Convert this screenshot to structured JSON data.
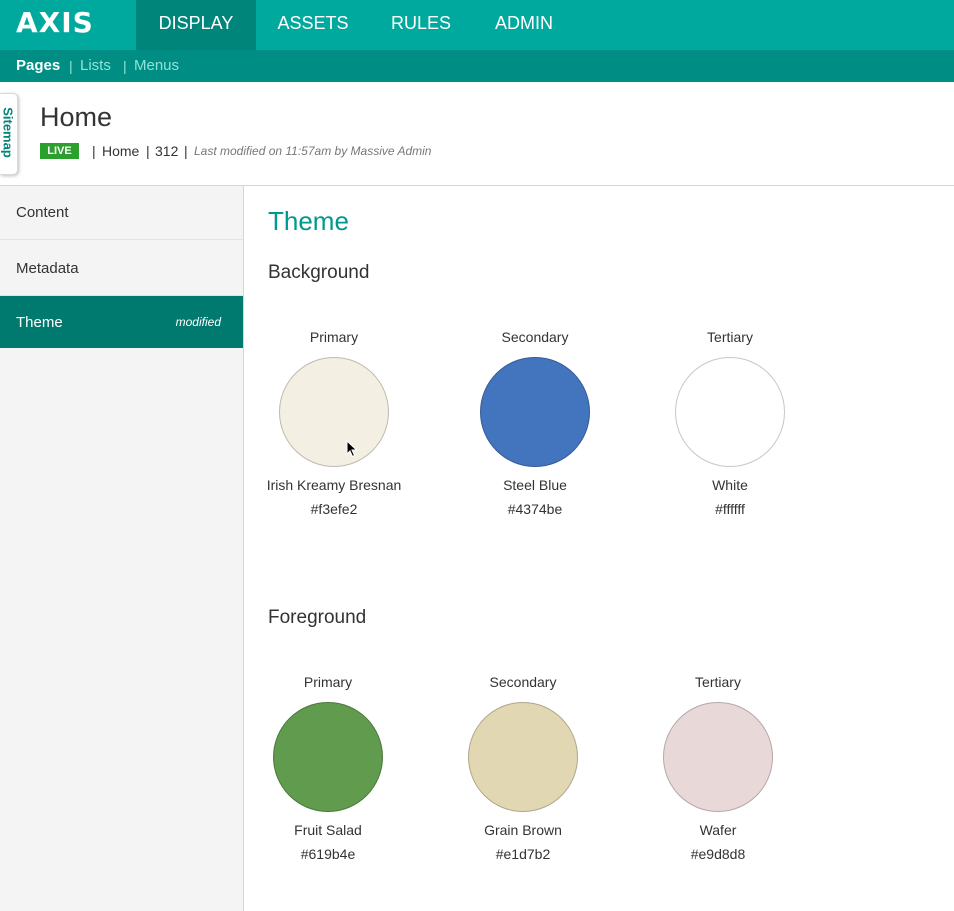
{
  "brand": {
    "logo": "AXIS"
  },
  "nav": {
    "items": [
      {
        "label": "DISPLAY"
      },
      {
        "label": "ASSETS"
      },
      {
        "label": "RULES"
      },
      {
        "label": "ADMIN"
      }
    ]
  },
  "subnav": {
    "items": [
      {
        "label": "Pages"
      },
      {
        "label": "Lists"
      },
      {
        "label": "Menus"
      }
    ],
    "separator": "|"
  },
  "sitemap": {
    "label": "Sitemap"
  },
  "page": {
    "title": "Home",
    "status": "LIVE",
    "breadcrumb": "Home",
    "id": "312",
    "modified": "Last modified on 11:57am by Massive Admin",
    "sep": "|"
  },
  "sidebar": {
    "items": [
      {
        "label": "Content"
      },
      {
        "label": "Metadata"
      },
      {
        "label": "Theme",
        "badge": "modified"
      }
    ]
  },
  "theme": {
    "title": "Theme",
    "background": {
      "title": "Background",
      "swatches": [
        {
          "role": "Primary",
          "name": "Irish Kreamy Bresnan",
          "hex": "#f3efe2"
        },
        {
          "role": "Secondary",
          "name": "Steel Blue",
          "hex": "#4374be"
        },
        {
          "role": "Tertiary",
          "name": "White",
          "hex": "#ffffff"
        }
      ]
    },
    "foreground": {
      "title": "Foreground",
      "swatches": [
        {
          "role": "Primary",
          "name": "Fruit Salad",
          "hex": "#619b4e"
        },
        {
          "role": "Secondary",
          "name": "Grain Brown",
          "hex": "#e1d7b2"
        },
        {
          "role": "Tertiary",
          "name": "Wafer",
          "hex": "#e9d8d8"
        }
      ]
    }
  },
  "colors": {
    "accent": "#00a99d",
    "accent_dark": "#00796f",
    "live": "#2ca02c"
  }
}
